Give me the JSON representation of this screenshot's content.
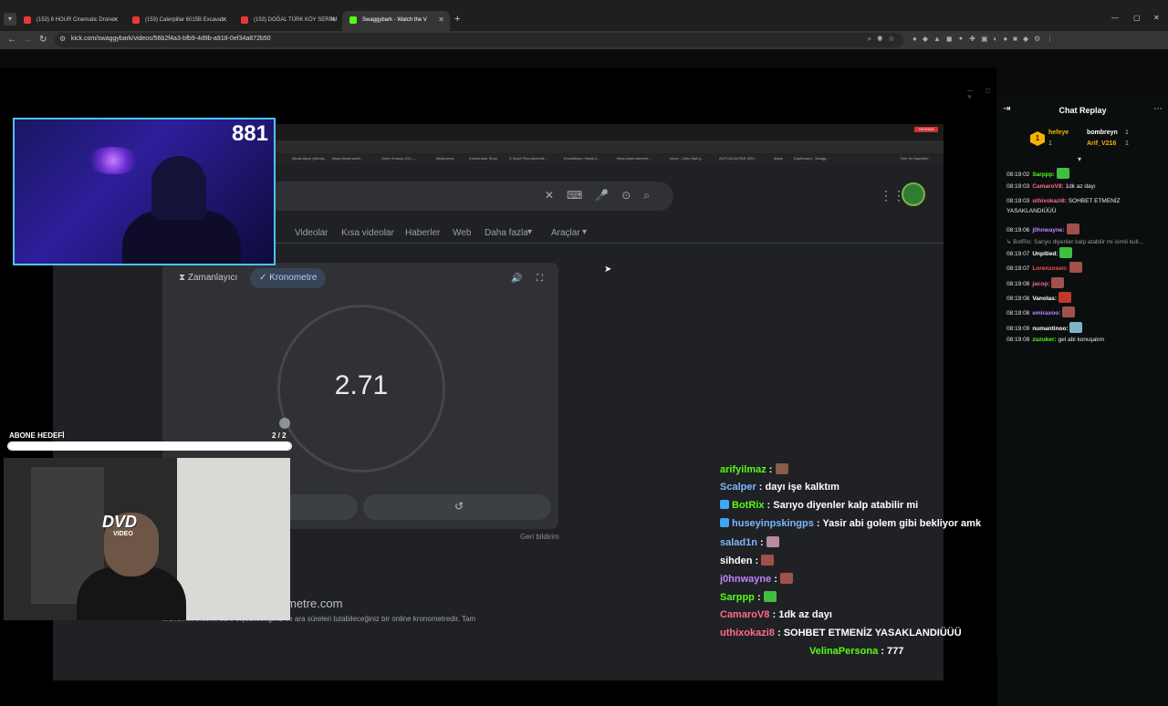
{
  "browser": {
    "tabs": [
      {
        "title": "(153) 8 HOUR Cinematic Drone",
        "favicon": "youtube-icon",
        "active": false
      },
      {
        "title": "(153) Caterpillar 6015B Excavat",
        "favicon": "youtube-icon",
        "active": false
      },
      {
        "title": "(153) DOĞAL TÜRK KÖY SERPM",
        "favicon": "youtube-icon",
        "active": false
      },
      {
        "title": "Swaggybark - Watch the V",
        "favicon": "kick-icon",
        "active": true
      }
    ],
    "url": "kick.com/swaggybark/videos/56b2f4a3-bfb9-4d9b-a918-0ef34a872b50"
  },
  "stream": {
    "viewer_count": "881",
    "sub_goal": {
      "label": "ABONE HEDEFİ",
      "count": "2 / 2",
      "progress": 1.0
    },
    "dvd_logo": "DVD",
    "dvd_sub": "VIDEO"
  },
  "shared_screen": {
    "live_badge": "YAYINDA",
    "bookmarks": [
      "Alican Alpar (@ewa...",
      "https://www.webli...",
      "Gelen Kutusu (21) -...",
      "Midjourney",
      "Kombinator Shop",
      "S Sport Plus Abonelik...",
      "Excalidraw | Hand-d...",
      "https://web.iskernet...",
      "Inbox - Zoho Mail (j...",
      "ALFCAN ALPAR DEV...",
      "Maps",
      "Dashboard - Swagg..."
    ],
    "bookmark_folder": "Tüm Yer İşaretleri",
    "nav": [
      "Videolar",
      "Kısa videolar",
      "Haberler",
      "Web",
      "Daha fazla",
      "Araçlar"
    ],
    "timer_tab": "Zamanlayıcı",
    "stopwatch_tab": "Kronometre",
    "stopwatch_value": "2.71",
    "feedback": "Geri bildirim",
    "site_host": "metre.com",
    "site_desc": "kronometre.com, süre ölçebileceğiniz ve ara süreleri tutabileceğiniz bir online kronometredir. Tam"
  },
  "overlay_chat": [
    {
      "user": "arifyilmaz",
      "text": "",
      "user_color": "#53fc18",
      "emote": "#8a5a4a"
    },
    {
      "user": "Scalper",
      "text": "dayı işe kalktım",
      "user_color": "#7ab8ff",
      "emote": ""
    },
    {
      "user": "BotRix",
      "text": "Sarıyo diyenler kalp atabilir mi",
      "user_color": "#53fc18",
      "emote": ""
    },
    {
      "user": "huseyinpskingps",
      "text": "Yasir abi golem gibi bekliyor amk",
      "user_color": "#7ab8ff",
      "emote": ""
    },
    {
      "user": "salad1n",
      "text": "",
      "user_color": "#7ab8ff",
      "emote": "#b98aa0"
    },
    {
      "user": "sihden",
      "text": "",
      "user_color": "#ffffff",
      "emote": "#a0524a"
    },
    {
      "user": "j0hnwayne",
      "text": "",
      "user_color": "#c084fc",
      "emote": "#a0524a"
    },
    {
      "user": "Sarppp",
      "text": "",
      "user_color": "#53fc18",
      "emote": "#3fbf3f"
    },
    {
      "user": "CamaroV8",
      "text": "1dk az dayı",
      "user_color": "#ff6b8a",
      "emote": ""
    },
    {
      "user": "uthixokazi8",
      "text": "SOHBET ETMENİZ YASAKLANDIÜÜÜ",
      "user_color": "#ff6b8a",
      "emote": ""
    },
    {
      "user": "VelinaPersona",
      "text": "777",
      "user_color": "#53fc18",
      "emote": ""
    }
  ],
  "sidebar": {
    "title": "Chat Replay",
    "pinned": [
      {
        "name": "hefeye",
        "num": "1",
        "color": "#f5b301"
      },
      {
        "name": "bombreyn",
        "num": "1",
        "color": "#ffffff"
      },
      {
        "name": "Arif_V216",
        "num": "1",
        "color": "#f5b301"
      }
    ],
    "pinned_rank": "1",
    "pinned_rank_num": "1",
    "messages": [
      {
        "time": "08:19:02",
        "user": "Sarppp:",
        "text": "",
        "user_color": "#53fc18",
        "emote": "#3fbf3f",
        "reply": ""
      },
      {
        "time": "08:19:03",
        "user": "CamaroV8:",
        "text": "1dk az dayı",
        "user_color": "#ff6b8a",
        "emote": "",
        "reply": ""
      },
      {
        "time": "08:19:03",
        "user": "uthixokazi8:",
        "text": "SOHBET ETMENİZ",
        "user_color": "#ff6b8a",
        "emote": "",
        "reply": ""
      },
      {
        "time": "",
        "user": "",
        "text": "YASAKLANDIÜÜÜ",
        "user_color": "#ffffff",
        "emote": "",
        "reply": ""
      },
      {
        "time": "08:19:06",
        "user": "j0hnwayne:",
        "text": "",
        "user_color": "#c084fc",
        "emote": "#a0524a",
        "reply": ""
      },
      {
        "time": "",
        "user": "",
        "text": "",
        "user_color": "#ffffff",
        "emote": "",
        "reply": "↳ BotRix: Sarıyo diyenler kalp atabilir mi isimli kull..."
      },
      {
        "time": "08:19:07",
        "user": "Unpitied:",
        "text": "",
        "user_color": "#ffffff",
        "emote": "#3fbf3f",
        "reply": ""
      },
      {
        "time": "08:19:07",
        "user": "Lorenzosen:",
        "text": "",
        "user_color": "#ff4d4d",
        "emote": "#a0524a",
        "reply": ""
      },
      {
        "time": "08:19:08",
        "user": "jacop:",
        "text": "",
        "user_color": "#ff6b8a",
        "emote": "#a0524a",
        "reply": ""
      },
      {
        "time": "08:19:08",
        "user": "Vanolas:",
        "text": "",
        "user_color": "#ffffff",
        "emote": "#c0392b",
        "reply": ""
      },
      {
        "time": "08:19:08",
        "user": "emiraxoo:",
        "text": "",
        "user_color": "#c084fc",
        "emote": "#a0524a",
        "reply": ""
      },
      {
        "time": "08:19:09",
        "user": "numantinoo:",
        "text": "",
        "user_color": "#ffffff",
        "emote": "#7fb3c8",
        "reply": ""
      },
      {
        "time": "08:19:09",
        "user": "zuzuker:",
        "text": "gel abi konuşalım",
        "user_color": "#53fc18",
        "emote": "",
        "reply": ""
      }
    ]
  },
  "colors": {
    "kick_green": "#53fc18",
    "cam_border": "#4fc3f7",
    "chip_active": "#394457"
  }
}
